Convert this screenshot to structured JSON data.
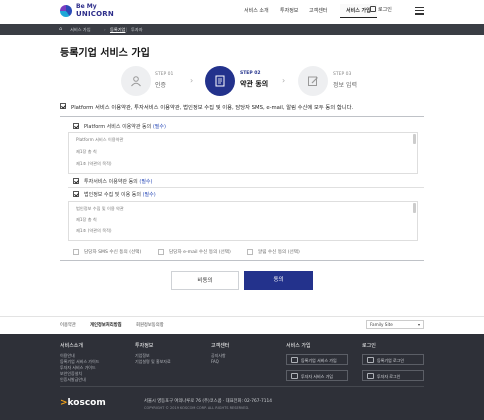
{
  "header": {
    "logo_line1": "Be My",
    "logo_line2": "UNICORN",
    "nav": [
      "서비스 소개",
      "투자정보",
      "고객센터",
      "서비스 가입"
    ],
    "login": "로그인"
  },
  "breadcrumb": {
    "items": [
      "서비스 가입",
      "등록기업",
      "투자자"
    ]
  },
  "page_title": "등록기업 서비스 가입",
  "steps": [
    {
      "no": "STEP 01",
      "name": "인증",
      "icon": "person-icon"
    },
    {
      "no": "STEP 02",
      "name": "약관 동의",
      "icon": "document-icon",
      "active": true
    },
    {
      "no": "STEP 03",
      "name": "정보 입력",
      "icon": "edit-icon"
    }
  ],
  "agree_all": "Platform 서비스 이용약관, 투자서비스 이용약관, 법인정보 수집 및 이용, 담당자 SMS, e-mail, 알림 수신에 모두 동의 합니다.",
  "terms": [
    {
      "label": "Platform 서비스 이용약관 동의",
      "req": "(필수)",
      "lines": [
        "Platform 서비스 이용약관",
        "제1장 총 칙",
        "제1조 (약관의 목적)"
      ]
    },
    {
      "label": "투자서비스 이용약관 동의",
      "req": "(필수)",
      "lines": []
    },
    {
      "label": "법인정보 수집 및 이용 동의",
      "req": "(필수)",
      "lines": [
        "법인정보 수집 및 이용 약관",
        "제1장 총 칙",
        "제1조 (약관의 목적)"
      ]
    }
  ],
  "optional": [
    "담당자 SMS 수신 동의 (선택)",
    "담당자 e-mail 수신 동의 (선택)",
    "알림 수신 동의 (선택)"
  ],
  "buttons": {
    "cancel": "비동의",
    "agree": "동의"
  },
  "subfooter": {
    "links": [
      "이용약관",
      "개인정보처리방침",
      "회원정보동의항"
    ],
    "family_site": "Family Site"
  },
  "footer": {
    "cols": [
      {
        "title": "서비스소개",
        "items": [
          "이용안내",
          "등록기업 서비스 가이드",
          "투자자 서비스 가이드",
          "보안인증설치",
          "인증서발급안내"
        ]
      },
      {
        "title": "투자정보",
        "items": [
          "기업정보",
          "기업설명 및 홍보자료"
        ]
      },
      {
        "title": "고객센터",
        "items": [
          "공지사항",
          "FAQ"
        ]
      }
    ],
    "join_title": "서비스 가입",
    "login_title": "로그인",
    "join_buttons": [
      "등록기업 서비스 가입",
      "투자자 서비스 가입"
    ],
    "login_buttons": [
      "등록기업 로그인",
      "투자자 로그인"
    ],
    "brand": "koscom",
    "address": "서울시 영등포구 여의나루로 76 (주)코스콤  ·  대표전화: 02-767-7114",
    "copyright": "COPYRIGHT © 2019 KOSCOM CORP. ALL RIGHTS RESERVED."
  }
}
